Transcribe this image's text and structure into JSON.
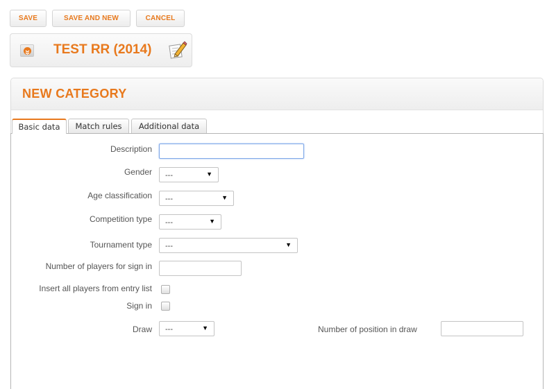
{
  "toolbar": {
    "save_label": "SAVE",
    "save_and_new_label": "SAVE AND NEW",
    "cancel_label": "CANCEL"
  },
  "tournament": {
    "title": "TEST RR (2014)",
    "expand_icon": "expand-icon",
    "edit_icon": "pencil-edit-icon"
  },
  "panel": {
    "title": "NEW CATEGORY"
  },
  "tabs": [
    {
      "label": "Basic data",
      "active": true
    },
    {
      "label": "Match rules",
      "active": false
    },
    {
      "label": "Additional data",
      "active": false
    }
  ],
  "form": {
    "description": {
      "label": "Description",
      "value": ""
    },
    "gender": {
      "label": "Gender",
      "value": "---"
    },
    "age_classification": {
      "label": "Age classification",
      "value": "---"
    },
    "competition_type": {
      "label": "Competition type",
      "value": "---"
    },
    "tournament_type": {
      "label": "Tournament type",
      "value": "---"
    },
    "players_sign_in": {
      "label": "Number of players for sign in",
      "value": ""
    },
    "insert_all_players": {
      "label": "Insert all players from entry list",
      "checked": false
    },
    "sign_in": {
      "label": "Sign in",
      "checked": false
    },
    "draw": {
      "label": "Draw",
      "value": "---"
    },
    "position_in_draw": {
      "label": "Number of position in draw",
      "value": ""
    }
  },
  "colors": {
    "accent": "#e8791d",
    "focus": "#7fa8e8"
  }
}
